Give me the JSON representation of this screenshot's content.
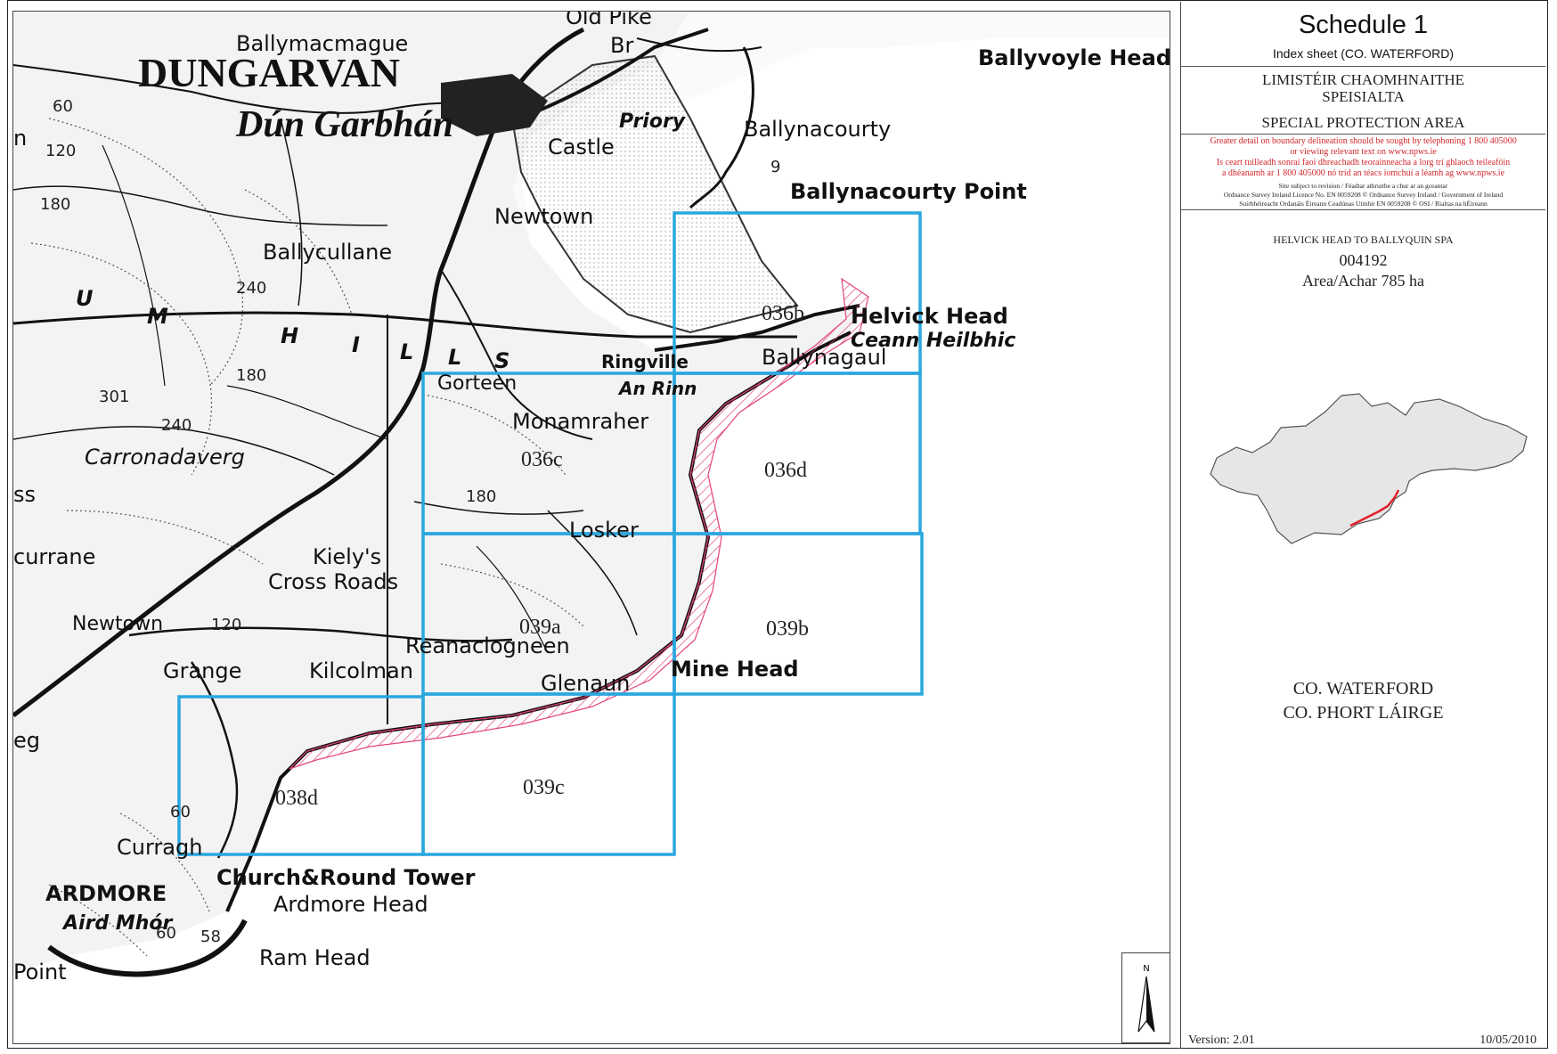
{
  "header": {
    "schedule_title": "Schedule 1",
    "index_sheet": "Index sheet (CO. WATERFORD)",
    "irish_name_line1": "LIMISTÉIR CHAOMHNAITHE",
    "irish_name_line2": "SPEISIALTA",
    "english_name": "SPECIAL PROTECTION AREA"
  },
  "notice": {
    "red_line1": "Greater detail on boundary delineation should be sought by telephoning 1 800 405000",
    "red_line2": "or viewing relevant text on www.npws.ie",
    "red_line3": "Is ceart tuilleadh sonraí faoi dhreachadh teorainneacha a lorg trí ghlaoch teileafóin",
    "red_line4": "a dhéanamh ar 1 800 405000 nó tríd an téacs iomchuí a léamh ag www.npws.ie",
    "small_line1": "Site subject to revision / Féadtar athruithe a chur ar an gceantar",
    "small_line2": "Ordnance Survey Ireland Licence No. EN 0059208 © Ordnance Survey Ireland / Government of Ireland",
    "small_line3": "Suirbhéireacht Ordanáis Éireann Ceadúnas Uimhir EN 0059208 © OSI / Rialtas na hÉireann"
  },
  "site": {
    "name": "HELVICK HEAD TO BALLYQUIN SPA",
    "code": "004192",
    "area": "Area/Achar 785 ha"
  },
  "county": {
    "english": "CO. WATERFORD",
    "irish": "CO. PHORT LÁIRGE"
  },
  "footer": {
    "version": "Version: 2.01",
    "date": "10/05/2010"
  },
  "north_arrow": {
    "label": "N"
  },
  "tiles": [
    {
      "id": "036b"
    },
    {
      "id": "036c"
    },
    {
      "id": "036d"
    },
    {
      "id": "039a"
    },
    {
      "id": "039b"
    },
    {
      "id": "039c"
    },
    {
      "id": "038d"
    }
  ],
  "place_names": {
    "dungarvan": "DUNGARVAN",
    "dun_garbhan": "Dún Garbhán",
    "ballymacmague": "Ballymacmague",
    "old_pike": "Old Pike",
    "br": "Br",
    "ballyvoyle_head": "Ballyvoyle Head",
    "priory": "Priory",
    "castle": "Castle",
    "ballynacourty": "Ballynacourty",
    "ballynacourty_point": "Ballynacourty Point",
    "newtown_north": "Newtown",
    "ballycullane": "Ballycullane",
    "helvick_head": "Helvick Head",
    "ceann_heilbhic": "Ceann Heilbhic",
    "ballynagaul": "Ballynagaul",
    "ringville": "Ringville",
    "an_rinn": "An Rinn",
    "gorteen": "Gorteen",
    "monamraher": "Monamraher",
    "carronadaverg": "Carronadaverg",
    "losker": "Losker",
    "kielys": "Kiely's",
    "cross_roads": "Cross Roads",
    "newtown_south": "Newtown",
    "reanaclogneen": "Reanaclogneen",
    "grange": "Grange",
    "kilcolman": "Kilcolman",
    "glenaun": "Glenaun",
    "mine_head": "Mine Head",
    "curragh": "Curragh",
    "ardmore": "ARDMORE",
    "aird_mhor": "Aird Mhór",
    "church_round_tower": "Church&Round Tower",
    "ardmore_head": "Ardmore Head",
    "ram_head": "Ram Head",
    "point": "Point",
    "currane": "currane",
    "ss": "ss",
    "eg": "eg",
    "hills_u": "U",
    "hills_m": "M",
    "hills_h": "H",
    "hills_i": "I",
    "hills_l1": "L",
    "hills_l2": "L",
    "hills_s": "S",
    "n_left": "n"
  },
  "spot_heights": {
    "h60a": "60",
    "h120": "120",
    "h180a": "180",
    "h240a": "240",
    "h180b": "180",
    "h301": "301",
    "h240b": "240",
    "h180c": "180",
    "h120b": "120",
    "h60b": "60",
    "h60c": "60",
    "h58": "58",
    "h9": "9"
  },
  "colors": {
    "tile_grid": "#2aa7df",
    "spa_boundary": "#e2457a",
    "notice_red": "#d1262c",
    "county_fill": "#e6e6e6"
  }
}
